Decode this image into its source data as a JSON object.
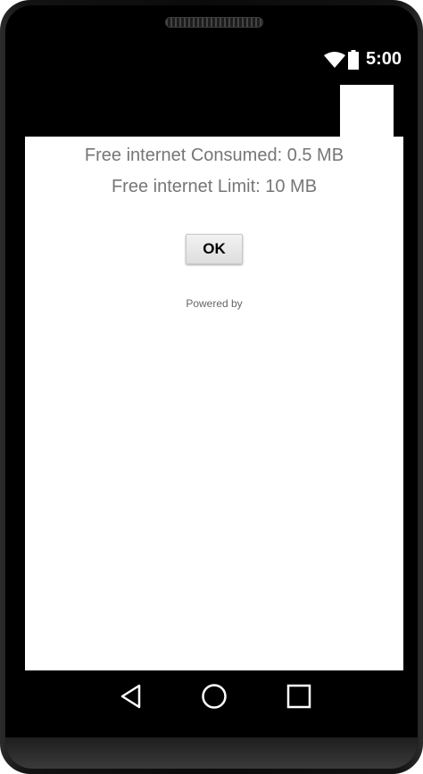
{
  "status_bar": {
    "time": "5:00",
    "icons": [
      "wifi-icon",
      "battery-icon"
    ]
  },
  "dialog": {
    "consumed_text": "Free internet Consumed: 0.5 MB",
    "limit_text": "Free internet Limit: 10 MB",
    "ok_label": "OK",
    "powered_by_text": "Powered by"
  },
  "nav_bar": {
    "icons": [
      "back-icon",
      "home-icon",
      "recent-apps-icon"
    ]
  },
  "colors": {
    "text_gray": "#767676",
    "button_bg": "#e6e6e6",
    "frame": "#000000"
  }
}
